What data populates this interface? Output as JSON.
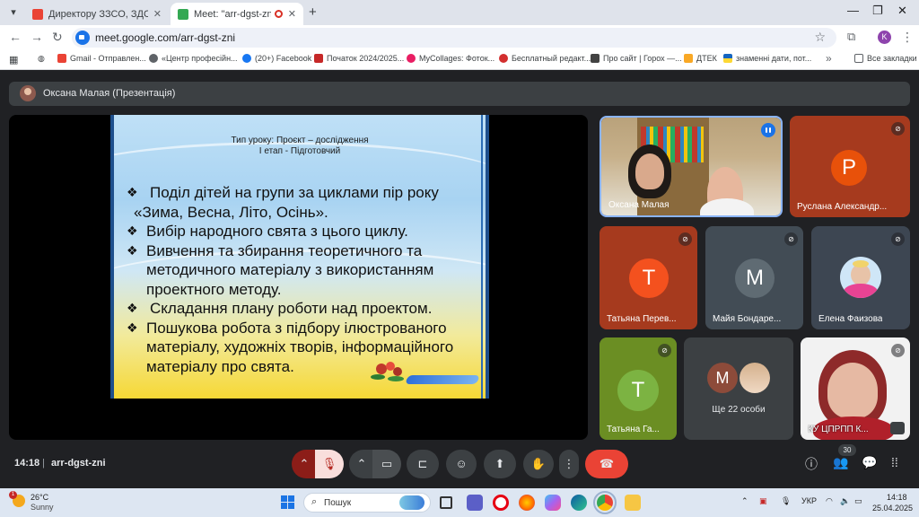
{
  "browser": {
    "tabs": [
      {
        "title": "Директору ЗЗСО, ЗДО. Запро",
        "favicon_color": "#ea4335"
      },
      {
        "title": "Meet: \"arr-dgst-zni\"",
        "favicon_color": "#34a853"
      }
    ],
    "url": "meet.google.com/arr-dgst-zni",
    "profile_initial": "K",
    "bookmarks": [
      {
        "label": "Gmail - Отправлен...",
        "color": "#ea4335"
      },
      {
        "label": "«Центр професійн...",
        "color": "#5f6368"
      },
      {
        "label": "(20+) Facebook",
        "color": "#1877f2"
      },
      {
        "label": "Початок 2024/2025...",
        "color": "#c62828"
      },
      {
        "label": "MyCollages: Фоток...",
        "color": "#e91e63"
      },
      {
        "label": "Бесплатный редакт...",
        "color": "#d32f2f"
      },
      {
        "label": "Про сайт | Горох —...",
        "color": "#424242"
      },
      {
        "label": "ДТЕК",
        "color": "#f9a825"
      },
      {
        "label": "знаменні дати, пот...",
        "color": "#1565c0"
      }
    ],
    "all_bookmarks_label": "Все закладки"
  },
  "meet": {
    "presenter_label": "Оксана Малая (Презентація)",
    "slide": {
      "title_line1": "Тип уроку: Проєкт – дослідження",
      "title_line2": "І етап - Підготовчий",
      "bullets": [
        {
          "text": "Поділ дітей на групи за циклами пір року",
          "cont": "«Зима, Весна, Літо, Осінь»."
        },
        {
          "text": "Вибір народного свята з цього циклу.",
          "cont": ""
        },
        {
          "text": "Вивчення та збирання теоретичного та",
          "cont": "методичного матеріалу з використанням проектного методу."
        },
        {
          "text": "Складання плану роботи над проектом.",
          "cont": ""
        },
        {
          "text": "Пошукова робота з підбору ілюстрованого",
          "cont": "матеріалу, художніх творів, інформаційного матеріалу про свята."
        }
      ]
    },
    "participants": [
      {
        "name": "Оксана Малая",
        "initial": "",
        "bg": "#c6ad88",
        "avatar_color": ""
      },
      {
        "name": "Руслана Александр...",
        "initial": "Р",
        "bg": "#a63a1e",
        "avatar_color": "#e8510a"
      },
      {
        "name": "Татьяна Перев...",
        "initial": "Т",
        "bg": "#a63a1e",
        "avatar_color": "#f4511e"
      },
      {
        "name": "Майя Бондаре...",
        "initial": "М",
        "bg": "#424c55",
        "avatar_color": "#5f6b73"
      },
      {
        "name": "Елена Фаизова",
        "initial": "",
        "bg": "#3d4652",
        "avatar_color": "#cfe6f7"
      },
      {
        "name": "Татьяна Га...",
        "initial": "Т",
        "bg": "#6b8e23",
        "avatar_color": "#7cb342"
      },
      {
        "name": "КУ ЦПРПП К...",
        "initial": "",
        "bg": "#eeeeee",
        "avatar_color": ""
      }
    ],
    "more_people": {
      "label": "Ще 22 особи",
      "initial": "М",
      "avatar_color": "#8d4b3a"
    },
    "control_bar": {
      "time": "14:18",
      "separator": "|",
      "meeting_code": "arr-dgst-zni",
      "participants_count": "30"
    }
  },
  "taskbar": {
    "temperature": "26°C",
    "condition": "Sunny",
    "weather_badge": "1",
    "search_placeholder": "Пошук",
    "language": "УКР",
    "time": "14:18",
    "date": "25.04.2025"
  }
}
